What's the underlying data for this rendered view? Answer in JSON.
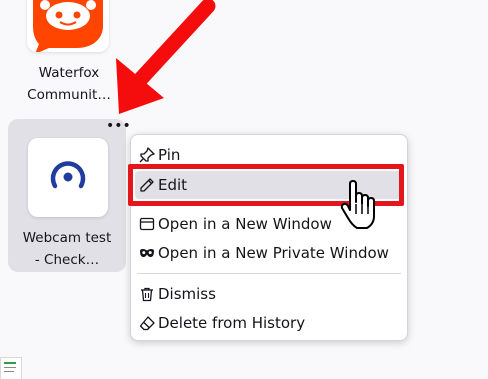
{
  "tiles": [
    {
      "label_line1": "Waterfox",
      "label_line2": "Communit…",
      "icon": "reddit-alien-icon"
    },
    {
      "label_line1": "Webcam test",
      "label_line2": "- Check…",
      "icon": "webcam-test-icon"
    }
  ],
  "tile_menu_button": "•••",
  "context_menu": {
    "items": [
      {
        "label": "Pin",
        "icon": "pin-icon"
      },
      {
        "label": "Edit",
        "icon": "pencil-icon"
      },
      {
        "label": "Open in a New Window",
        "icon": "window-icon"
      },
      {
        "label": "Open in a New Private Window",
        "icon": "private-mask-icon"
      },
      {
        "label": "Dismiss",
        "icon": "trash-icon"
      },
      {
        "label": "Delete from History",
        "icon": "eraser-icon"
      }
    ]
  },
  "colors": {
    "highlight_red": "#e4161b",
    "reddit_orange": "#ff4500",
    "webcam_blue": "#1f3c9e",
    "arrow_red": "#f50c0c"
  }
}
